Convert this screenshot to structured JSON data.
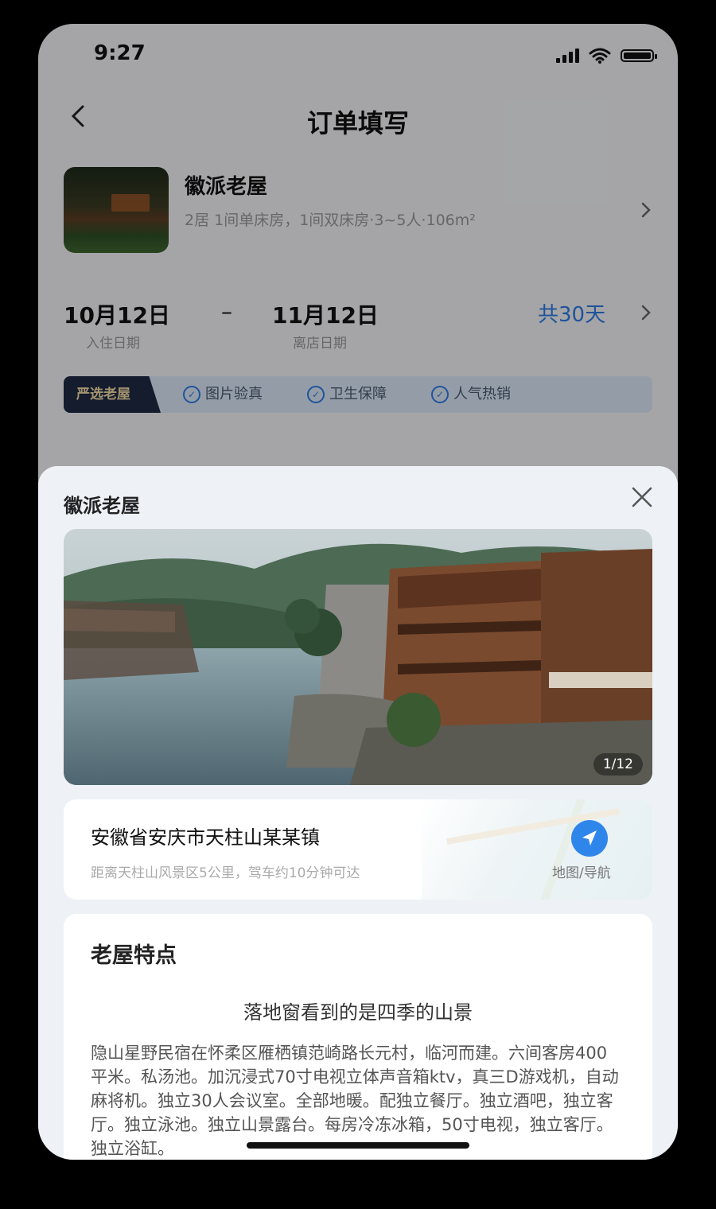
{
  "status_bar": {
    "time": "9:27"
  },
  "header": {
    "back_icon": "chevron-left-icon",
    "title": "订单填写"
  },
  "house": {
    "name": "徽派老屋",
    "desc": "2居  1间单床房，1间双床房·3~5人·106m²"
  },
  "dates": {
    "checkin": "10月12日",
    "checkin_label": "入住日期",
    "separator": "–",
    "checkout": "11月12日",
    "checkout_label": "离店日期",
    "total": "共30天"
  },
  "tags": {
    "featured": "严选老屋",
    "items": [
      "图片验真",
      "卫生保障",
      "人气热销"
    ]
  },
  "sheet": {
    "title": "徽派老屋",
    "photo_counter": "1/12",
    "address": "安徽省安庆市天柱山某某镇",
    "address_sub": "距离天柱山风景区5公里，驾车约10分钟可达",
    "nav_label": "地图/导航",
    "features_title": "老屋特点",
    "features_subtitle": "落地窗看到的是四季的山景",
    "features_body": "隐山星野民宿在怀柔区雁栖镇范崎路长元村，临河而建。六间客房400平米。私汤池。加沉浸式70寸电视立体声音箱ktv，真三D游戏机，自动麻将机。独立30人会议室。全部地暖。配独立餐厅。独立酒吧，独立客厅。独立泳池。独立山景露台。每房冷冻冰箱，50寸电视，独立客厅。独立浴缸。"
  },
  "colors": {
    "accent": "#2f7be5",
    "featured_bg": "#1e2a45",
    "featured_text": "#f0d9a2"
  }
}
